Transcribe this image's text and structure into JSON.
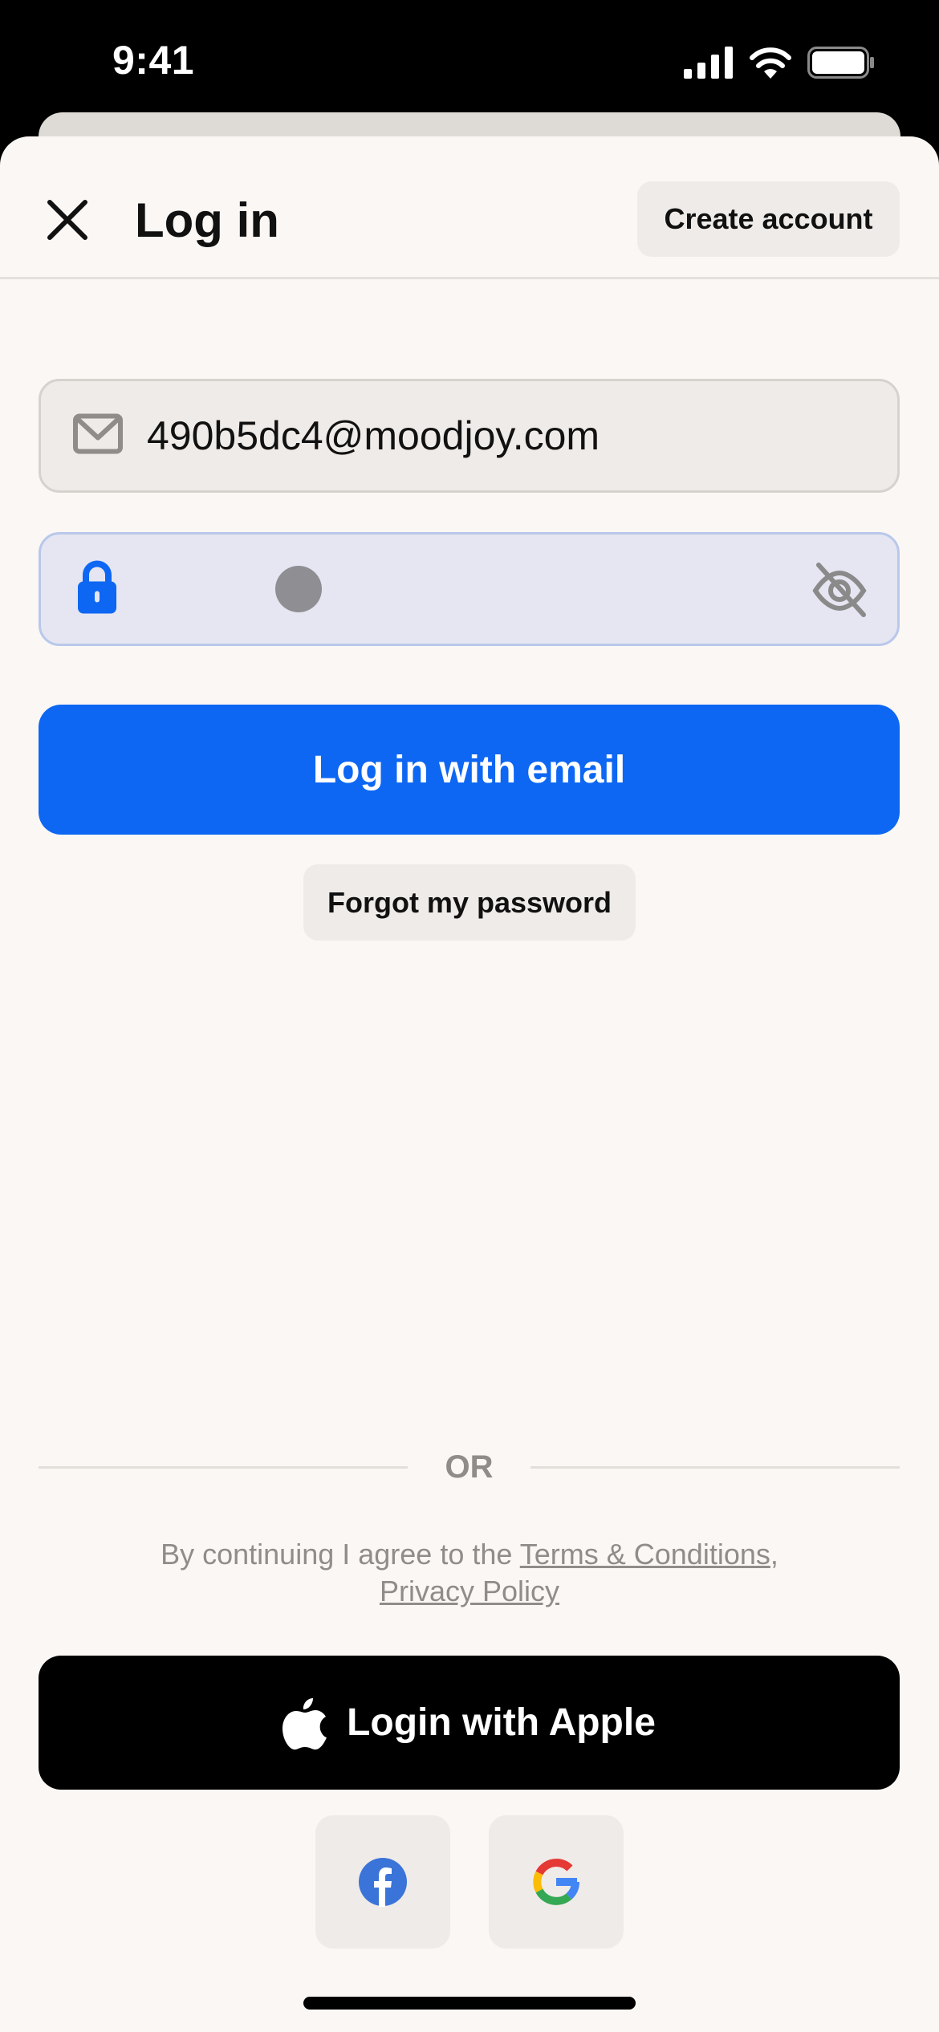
{
  "status_bar": {
    "time": "9:41",
    "icons": [
      "cellular-signal-icon",
      "wifi-icon",
      "battery-icon"
    ]
  },
  "header": {
    "close_icon": "close-icon",
    "title": "Log in",
    "create_account_label": "Create account"
  },
  "form": {
    "email": {
      "icon": "envelope-icon",
      "value": "490b5dc4@moodjoy.com"
    },
    "password": {
      "icon": "lock-icon",
      "masked_chars": 1,
      "visibility_icon": "eye-slash-icon"
    },
    "submit_label": "Log in with email",
    "forgot_label": "Forgot my password"
  },
  "divider": {
    "label": "OR"
  },
  "terms": {
    "prefix": "By continuing I agree to the ",
    "terms_link": "Terms & Conditions",
    "separator": ",",
    "privacy_link": "Privacy Policy"
  },
  "social": {
    "apple_label": "Login with Apple",
    "apple_icon": "apple-logo-icon",
    "facebook_icon": "facebook-logo-icon",
    "google_icon": "google-logo-icon"
  },
  "colors": {
    "accent": "#0d67f3",
    "background": "#fbf7f4",
    "secondary_button": "#efebe8",
    "password_field_bg": "#e5e6f2",
    "facebook_blue": "#3b74d8",
    "muted_text": "#8f8c89"
  }
}
